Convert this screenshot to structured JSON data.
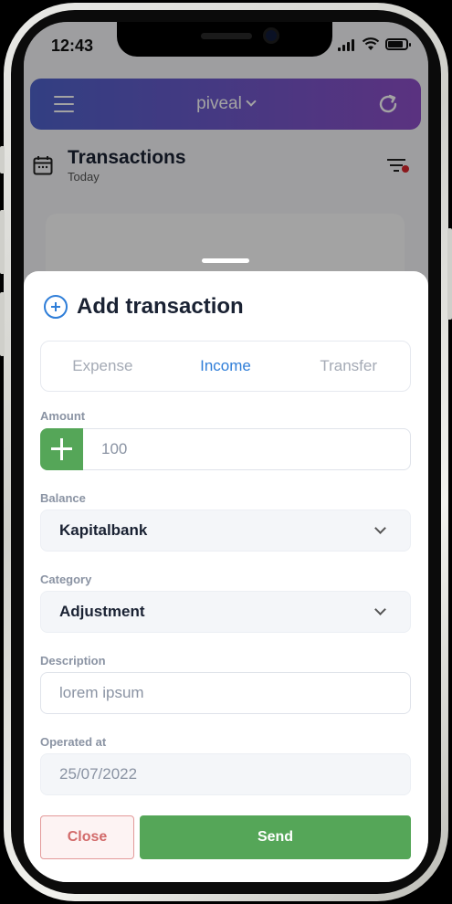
{
  "status": {
    "time": "12:43"
  },
  "appbar": {
    "brand": "piveal"
  },
  "page": {
    "title": "Transactions",
    "subtitle": "Today"
  },
  "sheet": {
    "title": "Add transaction",
    "tabs": [
      {
        "label": "Expense",
        "active": false
      },
      {
        "label": "Income",
        "active": true
      },
      {
        "label": "Transfer",
        "active": false
      }
    ],
    "amount": {
      "label": "Amount",
      "placeholder": "100"
    },
    "balance": {
      "label": "Balance",
      "value": "Kapitalbank"
    },
    "category": {
      "label": "Category",
      "value": "Adjustment"
    },
    "description": {
      "label": "Description",
      "placeholder": "lorem ipsum"
    },
    "operated_at": {
      "label": "Operated at",
      "value": "25/07/2022"
    },
    "close_label": "Close",
    "send_label": "Send"
  },
  "colors": {
    "accent": "#2f7ed8",
    "success": "#55a658",
    "danger": "#d26a6a",
    "header_start": "#4f63cc",
    "header_end": "#8e4fc9"
  }
}
